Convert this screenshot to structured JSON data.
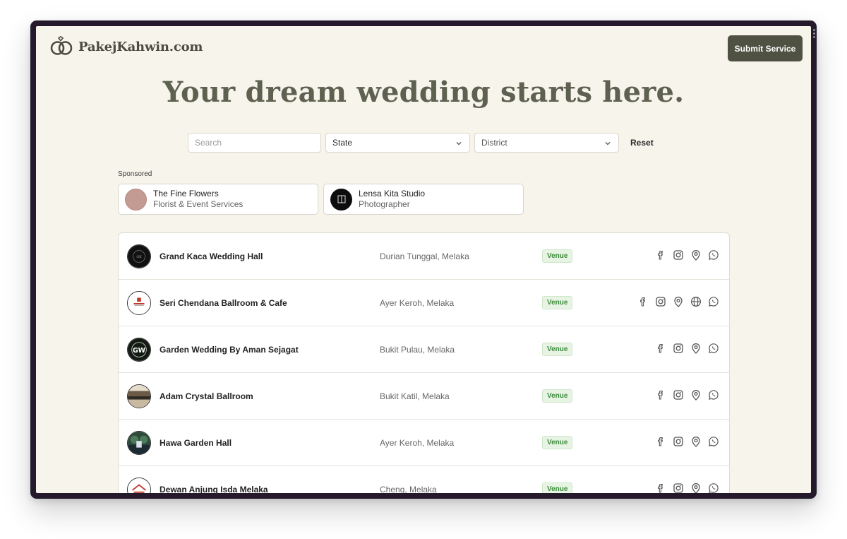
{
  "site": {
    "name": "PakejKahwin.com",
    "submit_label": "Submit Service"
  },
  "hero": {
    "title": "Your dream wedding starts here."
  },
  "filters": {
    "search_placeholder": "Search",
    "state_value": "State",
    "district_value": "District",
    "reset_label": "Reset"
  },
  "sponsored": {
    "label": "Sponsored",
    "items": [
      {
        "name": "The Fine Flowers",
        "category": "Florist & Event Services"
      },
      {
        "name": "Lensa Kita Studio",
        "category": "Photographer"
      }
    ]
  },
  "listings": [
    {
      "name": "Grand Kaca Wedding Hall",
      "location": "Durian Tunggal, Melaka",
      "category": "Venue",
      "links": [
        "facebook",
        "instagram",
        "map-pin",
        "whatsapp"
      ]
    },
    {
      "name": "Seri Chendana Ballroom & Cafe",
      "location": "Ayer Keroh, Melaka",
      "category": "Venue",
      "links": [
        "facebook",
        "instagram",
        "map-pin",
        "globe",
        "whatsapp"
      ]
    },
    {
      "name": "Garden Wedding By Aman Sejagat",
      "location": "Bukit Pulau, Melaka",
      "category": "Venue",
      "links": [
        "facebook",
        "instagram",
        "map-pin",
        "whatsapp"
      ]
    },
    {
      "name": "Adam Crystal Ballroom",
      "location": "Bukit Katil, Melaka",
      "category": "Venue",
      "links": [
        "facebook",
        "instagram",
        "map-pin",
        "whatsapp"
      ]
    },
    {
      "name": "Hawa Garden Hall",
      "location": "Ayer Keroh, Melaka",
      "category": "Venue",
      "links": [
        "facebook",
        "instagram",
        "map-pin",
        "whatsapp"
      ]
    },
    {
      "name": "Dewan Anjung Isda Melaka",
      "location": "Cheng, Melaka",
      "category": "Venue",
      "links": [
        "facebook",
        "instagram",
        "map-pin",
        "whatsapp"
      ]
    }
  ],
  "colors": {
    "background": "#f7f4ec",
    "accent": "#4f5243",
    "heading": "#5e6150",
    "badge_bg": "#e7f4e4",
    "badge_text": "#3d8a3c"
  }
}
